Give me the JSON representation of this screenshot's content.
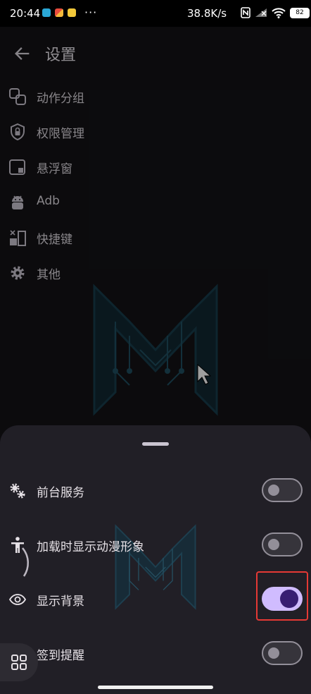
{
  "status_bar": {
    "time": "20:44",
    "more": "···",
    "net_speed": "38.8K/s",
    "battery": "82",
    "icons": [
      "app-notification-1-icon",
      "app-notification-2-icon",
      "app-notification-3-icon",
      "nfc-icon",
      "signal-icon",
      "wifi-icon",
      "battery-icon"
    ]
  },
  "app_bar": {
    "title": "设置",
    "back_icon": "arrow-back-icon"
  },
  "menu": {
    "items": [
      {
        "label": "动作分组",
        "icon": "group-icon"
      },
      {
        "label": "权限管理",
        "icon": "shield-lock-icon"
      },
      {
        "label": "悬浮窗",
        "icon": "floating-window-icon"
      },
      {
        "label": "Adb",
        "icon": "android-icon"
      },
      {
        "label": "快捷键",
        "icon": "shortcut-icon"
      },
      {
        "label": "其他",
        "icon": "gear-icon"
      }
    ]
  },
  "sheet": {
    "items": [
      {
        "label": "前台服务",
        "icon": "gears-icon",
        "enabled": false
      },
      {
        "label": "加载时显示动漫形象",
        "icon": "figure-icon",
        "enabled": false
      },
      {
        "label": "显示背景",
        "icon": "eye-icon",
        "enabled": true
      },
      {
        "label": "签到提醒",
        "icon": "bell-icon",
        "enabled": false
      }
    ]
  },
  "colors": {
    "background": "#141316",
    "sheet": "#211f26",
    "switch_on_track": "#d0bcff",
    "switch_on_thumb": "#381e72",
    "highlight": "#e53935",
    "logo_accent": "#1a5f78"
  }
}
